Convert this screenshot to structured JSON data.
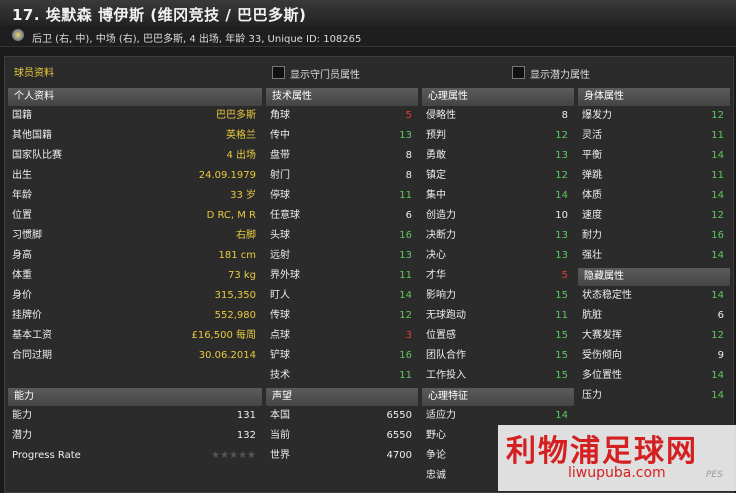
{
  "title": "17. 埃默森 博伊斯 (维冈竞技 / 巴巴多斯)",
  "info": "后卫 (右, 中), 中场 (右), 巴巴多斯, 4 出场, 年龄 33, Unique ID: 108265",
  "section": "球员资料",
  "checkbox_gk": "显示守门员属性",
  "checkbox_potential": "显示潜力属性",
  "personal": {
    "header": "个人资料",
    "rows": [
      {
        "k": "国籍",
        "v": "巴巴多斯"
      },
      {
        "k": "其他国籍",
        "v": "英格兰"
      },
      {
        "k": "国家队比赛",
        "v": "4 出场"
      },
      {
        "k": "出生",
        "v": "24.09.1979"
      },
      {
        "k": "年龄",
        "v": "33 岁"
      },
      {
        "k": "位置",
        "v": "D RC, M R"
      },
      {
        "k": "习惯脚",
        "v": "右脚"
      },
      {
        "k": "身高",
        "v": "181 cm"
      },
      {
        "k": "体重",
        "v": "73 kg"
      },
      {
        "k": "身价",
        "v": "315,350"
      },
      {
        "k": "挂牌价",
        "v": "552,980"
      },
      {
        "k": "基本工资",
        "v": "£16,500 每周"
      },
      {
        "k": "合同过期",
        "v": "30.06.2014"
      }
    ]
  },
  "ability": {
    "header": "能力",
    "rows": [
      {
        "k": "能力",
        "v": "131"
      },
      {
        "k": "潜力",
        "v": "132"
      },
      {
        "k": "Progress Rate",
        "v": "★★★★★"
      }
    ]
  },
  "technical": {
    "header": "技术属性",
    "rows": [
      {
        "k": "角球",
        "v": "5",
        "c": "r"
      },
      {
        "k": "传中",
        "v": "13",
        "c": "g"
      },
      {
        "k": "盘带",
        "v": "8",
        "c": "w"
      },
      {
        "k": "射门",
        "v": "8",
        "c": "w"
      },
      {
        "k": "停球",
        "v": "11",
        "c": "g"
      },
      {
        "k": "任意球",
        "v": "6",
        "c": "w"
      },
      {
        "k": "头球",
        "v": "16",
        "c": "g"
      },
      {
        "k": "远射",
        "v": "13",
        "c": "g"
      },
      {
        "k": "界外球",
        "v": "11",
        "c": "g"
      },
      {
        "k": "盯人",
        "v": "14",
        "c": "g"
      },
      {
        "k": "传球",
        "v": "12",
        "c": "g"
      },
      {
        "k": "点球",
        "v": "3",
        "c": "r"
      },
      {
        "k": "铲球",
        "v": "16",
        "c": "g"
      },
      {
        "k": "技术",
        "v": "11",
        "c": "g"
      }
    ]
  },
  "reputation": {
    "header": "声望",
    "rows": [
      {
        "k": "本国",
        "v": "6550"
      },
      {
        "k": "当前",
        "v": "6550"
      },
      {
        "k": "世界",
        "v": "4700"
      }
    ]
  },
  "mental": {
    "header": "心理属性",
    "rows": [
      {
        "k": "侵略性",
        "v": "8",
        "c": "w"
      },
      {
        "k": "预判",
        "v": "12",
        "c": "g"
      },
      {
        "k": "勇敢",
        "v": "13",
        "c": "g"
      },
      {
        "k": "镇定",
        "v": "12",
        "c": "g"
      },
      {
        "k": "集中",
        "v": "14",
        "c": "g"
      },
      {
        "k": "创造力",
        "v": "10",
        "c": "w"
      },
      {
        "k": "决断力",
        "v": "13",
        "c": "g"
      },
      {
        "k": "决心",
        "v": "13",
        "c": "g"
      },
      {
        "k": "才华",
        "v": "5",
        "c": "r"
      },
      {
        "k": "影响力",
        "v": "15",
        "c": "g"
      },
      {
        "k": "无球跑动",
        "v": "11",
        "c": "g"
      },
      {
        "k": "位置感",
        "v": "15",
        "c": "g"
      },
      {
        "k": "团队合作",
        "v": "15",
        "c": "g"
      },
      {
        "k": "工作投入",
        "v": "15",
        "c": "g"
      }
    ]
  },
  "traits": {
    "header": "心理特征",
    "rows": [
      {
        "k": "适应力",
        "v": "14"
      },
      {
        "k": "野心",
        "v": ""
      },
      {
        "k": "争论",
        "v": ""
      },
      {
        "k": "忠诚",
        "v": ""
      }
    ]
  },
  "physical": {
    "header": "身体属性",
    "rows": [
      {
        "k": "爆发力",
        "v": "12",
        "c": "g"
      },
      {
        "k": "灵活",
        "v": "11",
        "c": "g"
      },
      {
        "k": "平衡",
        "v": "14",
        "c": "g"
      },
      {
        "k": "弹跳",
        "v": "11",
        "c": "g"
      },
      {
        "k": "体质",
        "v": "14",
        "c": "g"
      },
      {
        "k": "速度",
        "v": "12",
        "c": "g"
      },
      {
        "k": "耐力",
        "v": "16",
        "c": "g"
      },
      {
        "k": "强壮",
        "v": "14",
        "c": "g"
      }
    ]
  },
  "hidden": {
    "header": "隐藏属性",
    "rows": [
      {
        "k": "状态稳定性",
        "v": "14",
        "c": "g"
      },
      {
        "k": "肮脏",
        "v": "6",
        "c": "w"
      },
      {
        "k": "大赛发挥",
        "v": "12",
        "c": "g"
      },
      {
        "k": "受伤倾向",
        "v": "9",
        "c": "w"
      },
      {
        "k": "多位置性",
        "v": "14",
        "c": "g"
      },
      {
        "k": "压力",
        "v": "14",
        "c": "g"
      }
    ]
  },
  "watermark": {
    "cn": "利物浦足球网",
    "en": "liwupuba.com",
    "pes": "PES"
  }
}
